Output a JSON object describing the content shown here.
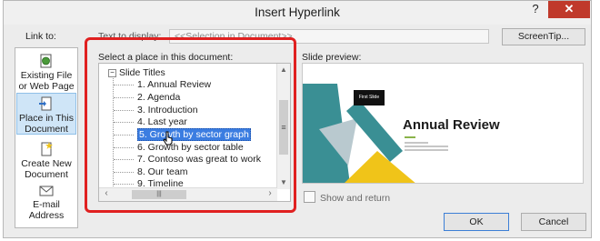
{
  "window": {
    "title": "Insert Hyperlink",
    "help_label": "?",
    "close_label": "✕"
  },
  "link_to": {
    "label": "Link to:",
    "items": [
      {
        "label1": "Existing File",
        "label2": "or Web Page",
        "icon": "globe-document-icon"
      },
      {
        "label1": "Place in This",
        "label2": "Document",
        "icon": "document-place-icon",
        "active": true
      },
      {
        "label1": "Create New",
        "label2": "Document",
        "icon": "new-document-icon"
      },
      {
        "label1": "E-mail",
        "label2": "Address",
        "icon": "email-icon"
      }
    ]
  },
  "text_to_display": {
    "label": "Text to display:",
    "value": "<<Selection in Document>>"
  },
  "screentip_label": "ScreenTip...",
  "place": {
    "label": "Select a place in this document:",
    "root": "Slide Titles",
    "root_toggle": "−",
    "items": [
      "1. Annual Review",
      "2. Agenda",
      "3. Introduction",
      "4. Last year",
      "5. Growth by sector graph",
      "6. Growth by sector table",
      "7. Contoso was great to work",
      "8. Our team",
      "9. Timeline"
    ],
    "selected_index": 4
  },
  "preview": {
    "label": "Slide preview:",
    "first_slide": "First Slide",
    "title": "Annual Review"
  },
  "show_and_return_label": "Show and return",
  "buttons": {
    "ok": "OK",
    "cancel": "Cancel"
  },
  "colors": {
    "selection": "#3b7de1",
    "annotation": "#e02020",
    "teal": "#3a8f94",
    "yellow": "#f0c419",
    "green": "#8ab34a"
  }
}
